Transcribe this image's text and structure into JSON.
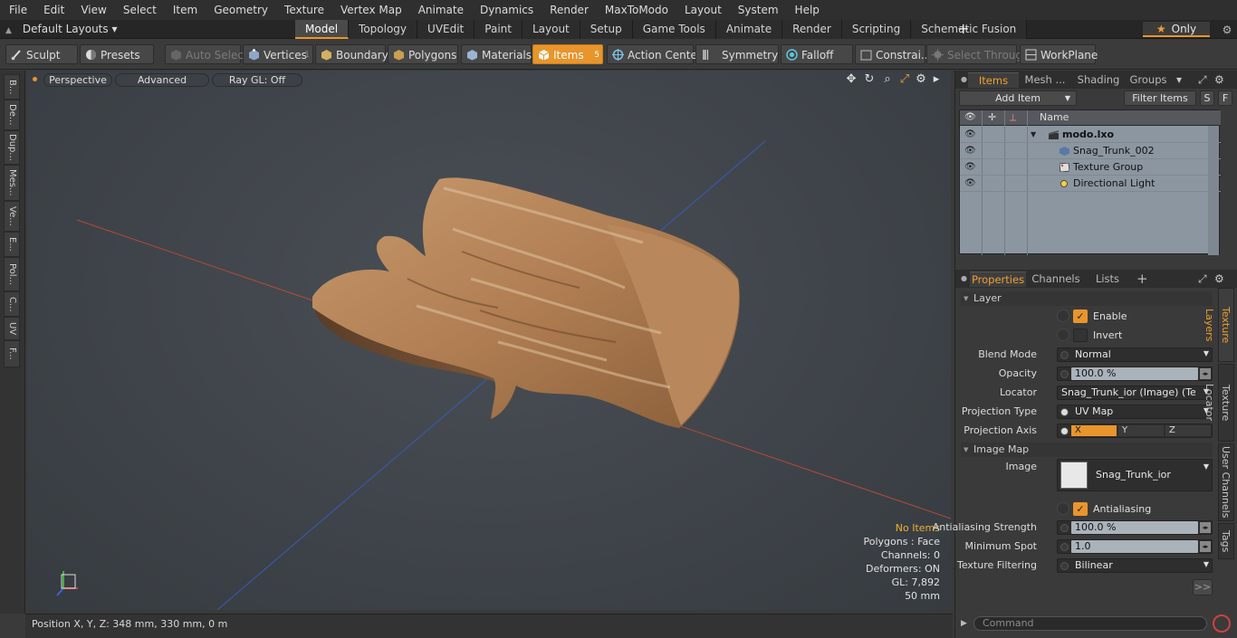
{
  "menu": [
    "File",
    "Edit",
    "View",
    "Select",
    "Item",
    "Geometry",
    "Texture",
    "Vertex Map",
    "Animate",
    "Dynamics",
    "Render",
    "MaxToModo",
    "Layout",
    "System",
    "Help"
  ],
  "layout_select": "Default Layouts",
  "mode_tabs": [
    "Model",
    "Topology",
    "UVEdit",
    "Paint",
    "Layout",
    "Setup",
    "Game Tools",
    "Animate",
    "Render",
    "Scripting",
    "Schematic Fusion"
  ],
  "only_label": "Only",
  "toolbar": {
    "sculpt": "Sculpt",
    "presets": "Presets",
    "auto_select": "Auto Select",
    "vertices": "Vertices",
    "vertices_count": "1",
    "boundary": "Boundary",
    "polygons": "Polygons",
    "materials": "Materials",
    "items": "Items",
    "items_count": "5",
    "action_center": "Action Center",
    "symmetry": "Symmetry",
    "falloff": "Falloff",
    "constraints": "Constrai...",
    "select_through": "Select Through",
    "workplane": "WorkPlane"
  },
  "left_tabs": [
    "B...",
    "De...",
    "Dup...",
    "Mes...",
    "Ve...",
    "E...",
    "Pol...",
    "C...",
    "UV",
    "F..."
  ],
  "viewport": {
    "perspective": "Perspective",
    "advanced": "Advanced",
    "raygl": "Ray GL: Off",
    "stats": {
      "items": "No Items",
      "polygons": "Polygons : Face",
      "channels": "Channels: 0",
      "deformers": "Deformers: ON",
      "gl": "GL: 7,892",
      "size": "50 mm"
    }
  },
  "status": "Position X, Y, Z:   348 mm, 330 mm, 0 m",
  "items_panel": {
    "tabs": [
      "Items",
      "Mesh ...",
      "Shading",
      "Groups"
    ],
    "add_item": "Add Item",
    "filter_items": "Filter Items",
    "s_btn": "S",
    "f_btn": "F",
    "name_header": "Name",
    "rows": [
      {
        "label": "modo.lxo"
      },
      {
        "label": "Snag_Trunk_002"
      },
      {
        "label": "Texture Group"
      },
      {
        "label": "Directional Light"
      }
    ]
  },
  "props_panel": {
    "tabs": [
      "Properties",
      "Channels",
      "Lists"
    ],
    "layer_section": "Layer",
    "enable": "Enable",
    "invert": "Invert",
    "blend_mode_label": "Blend Mode",
    "blend_mode": "Normal",
    "opacity_label": "Opacity",
    "opacity": "100.0 %",
    "locator_label": "Locator",
    "locator": "Snag_Trunk_ior (Image) (Tex ...",
    "projection_type_label": "Projection Type",
    "projection_type": "UV Map",
    "projection_axis_label": "Projection Axis",
    "axis_x": "X",
    "axis_y": "Y",
    "axis_z": "Z",
    "image_map_section": "Image Map",
    "image_label": "Image",
    "image": "Snag_Trunk_ior",
    "antialiasing": "Antialiasing",
    "aa_strength_label": "Antialiasing Strength",
    "aa_strength": "100.0 %",
    "min_spot_label": "Minimum Spot",
    "min_spot": "1.0",
    "tex_filter_label": "Texture Filtering",
    "tex_filter": "Bilinear",
    "more": ">>",
    "vtabs": [
      "Texture Layers",
      "Texture Locator",
      "User Channels",
      "Tags"
    ]
  },
  "command_placeholder": "Command",
  "colors": {
    "accent": "#e8952c",
    "list_bg": "#8c96a0"
  }
}
